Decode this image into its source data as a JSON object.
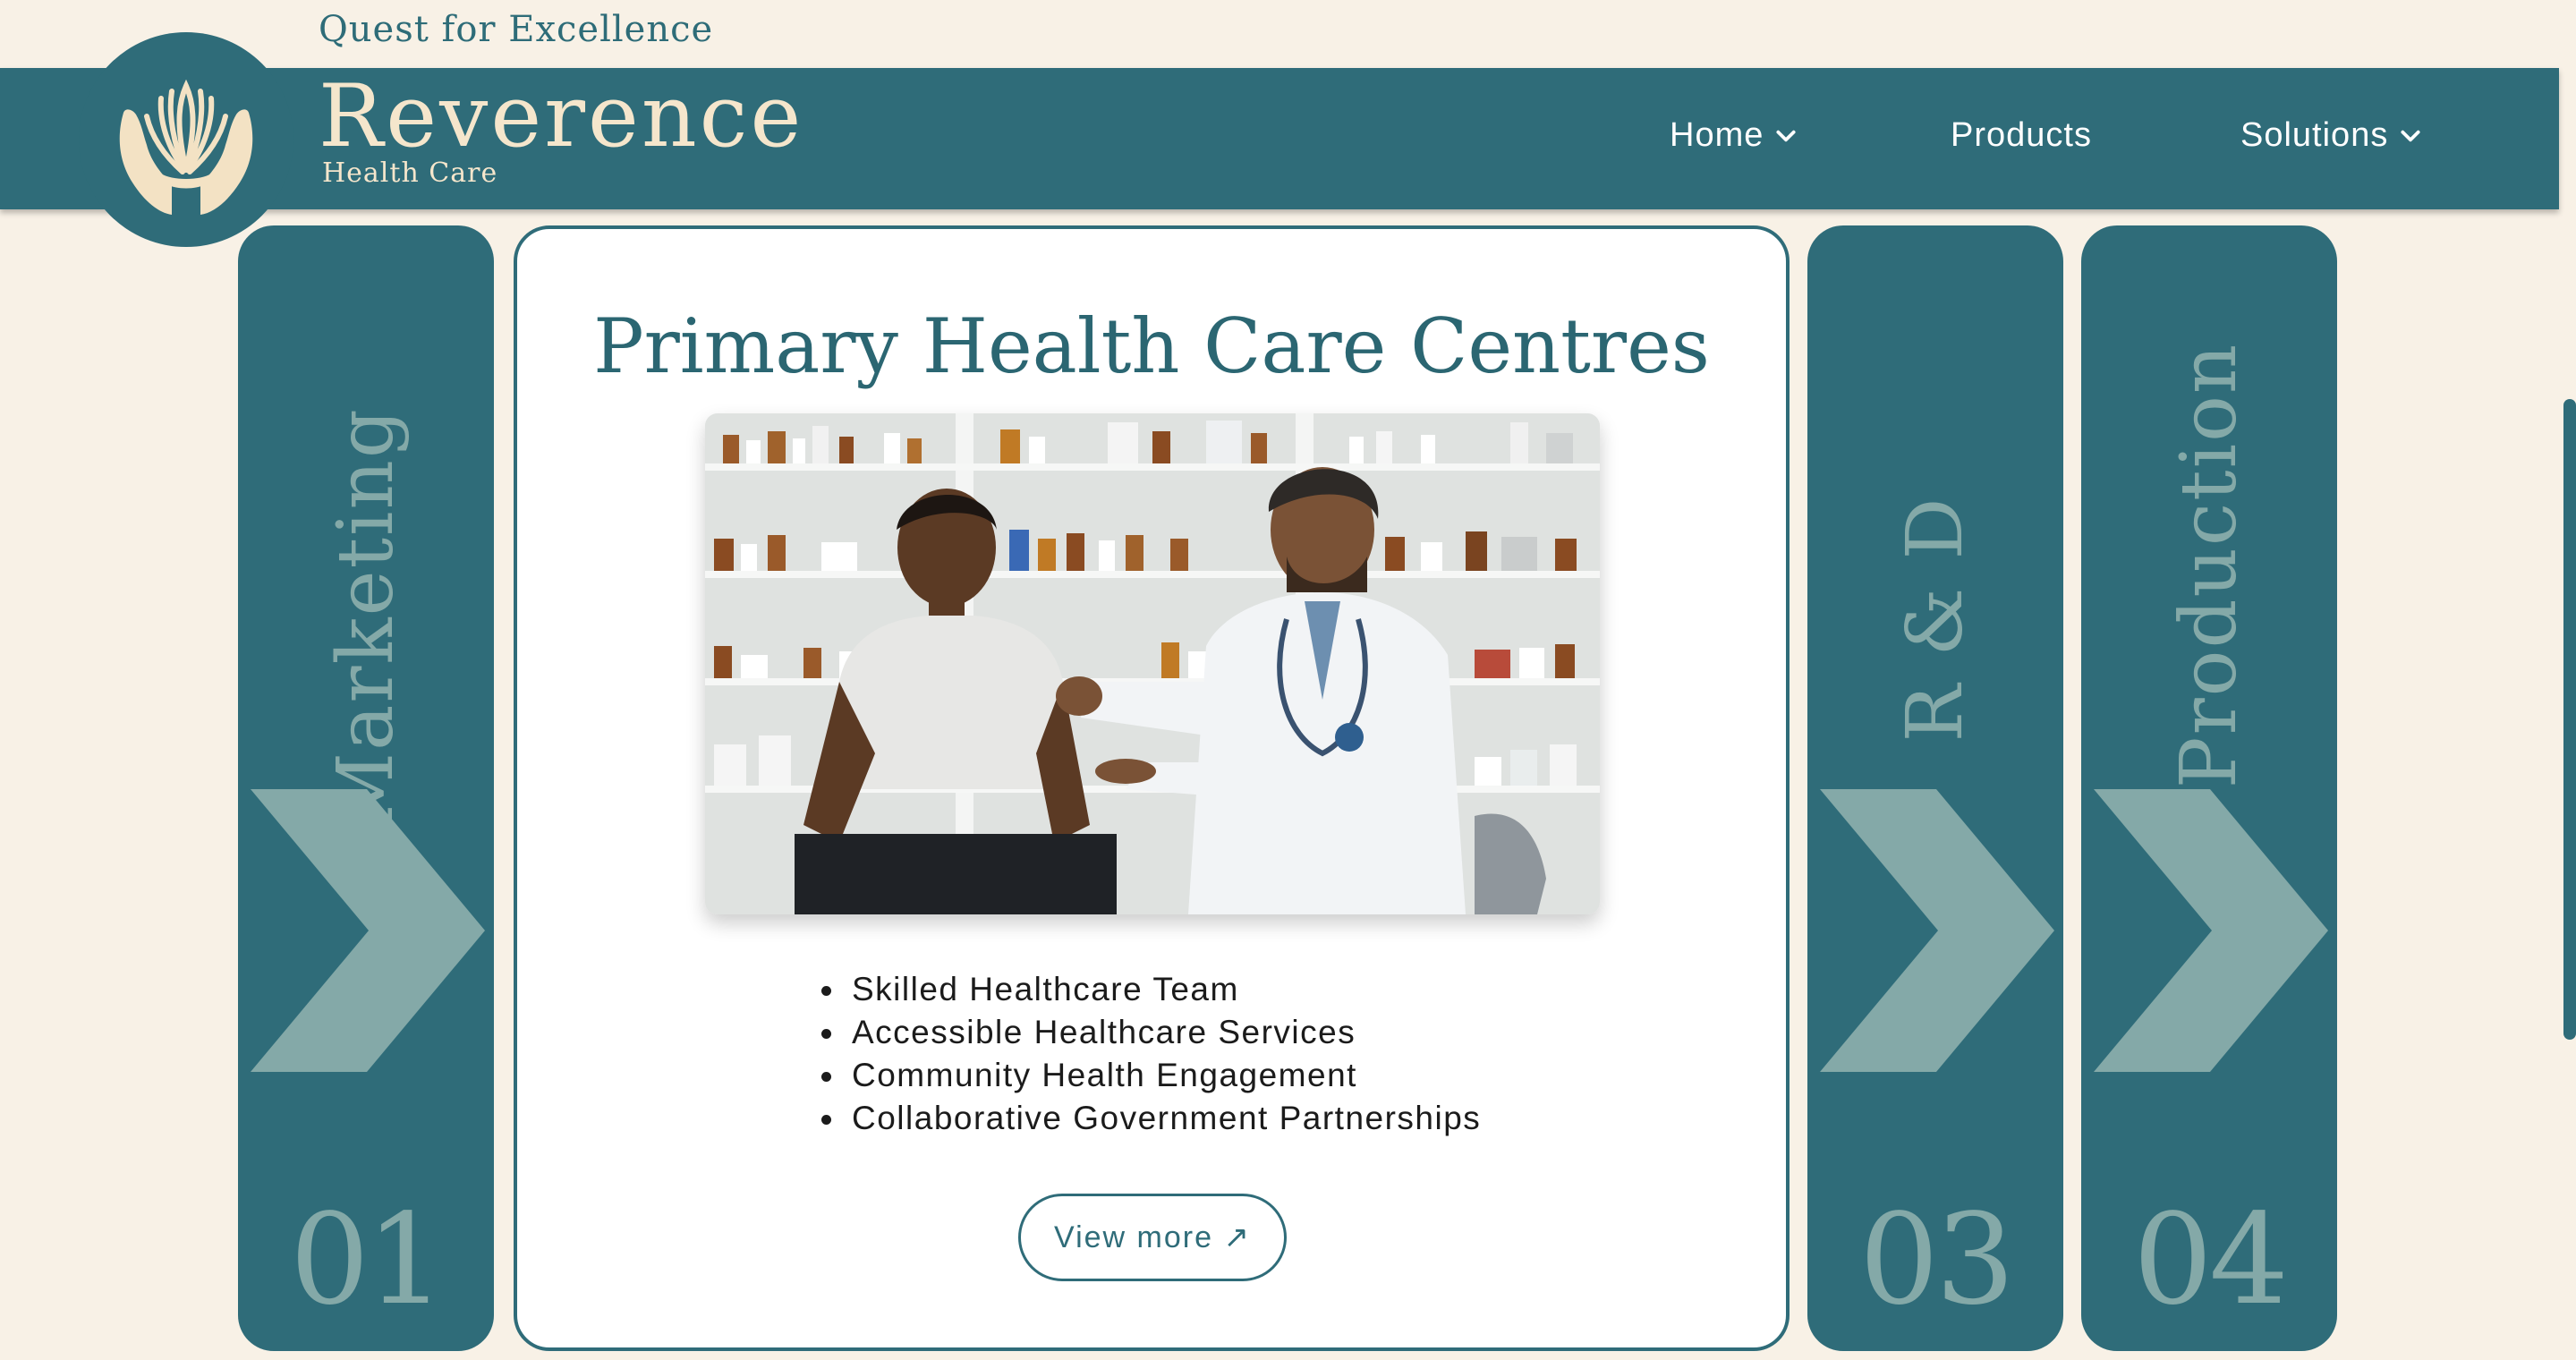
{
  "header": {
    "tagline": "Quest for Excellence",
    "brand_name": "Reverence",
    "brand_sub": "Health Care",
    "logo_icon": "hands-lotus-icon",
    "nav": [
      {
        "label": "Home",
        "has_dropdown": true
      },
      {
        "label": "Products",
        "has_dropdown": false
      },
      {
        "label": "Solutions",
        "has_dropdown": true
      }
    ]
  },
  "panels": [
    {
      "label": "Marketing",
      "number": "01"
    },
    {
      "label": "R & D",
      "number": "03"
    },
    {
      "label": "Production",
      "number": "04"
    }
  ],
  "card": {
    "title": "Primary Health Care Centres",
    "image_alt": "Doctor consulting a patient in a pharmacy",
    "features": [
      "Skilled Healthcare Team",
      "Accessible Healthcare Services",
      "Community Health Engagement",
      "Collaborative Government Partnerships"
    ],
    "button_label": "View more ↗"
  },
  "colors": {
    "brand_teal": "#2f6c79",
    "background_cream": "#f8f1e6",
    "accent_sage": "#84a9a8",
    "logo_cream": "#f5e6cc"
  }
}
